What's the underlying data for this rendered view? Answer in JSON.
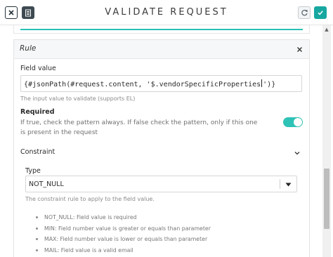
{
  "header": {
    "title": "VALIDATE REQUEST",
    "close_icon": "close-icon",
    "doc_icon": "document-icon",
    "refresh_icon": "refresh-icon",
    "check_icon": "check-icon"
  },
  "rule": {
    "title": "Rule",
    "field_value": {
      "label": "Field value",
      "value_before_caret": "{#jsonPath(#request.content, '$.vendorSpecificProperties",
      "value_after_caret": "')}",
      "hint": "The input value to validate (supports EL)"
    },
    "required": {
      "title": "Required",
      "description": "If true, check the pattern always. If false check the pattern, only if this one is present in the request",
      "enabled": true
    },
    "constraint": {
      "title": "Constraint",
      "type_label": "Type",
      "type_value": "NOT_NULL",
      "type_hint": "The constraint rule to apply to the field value.",
      "items": [
        "NOT_NULL: Field value is required",
        "MIN: Field number value is greater or equals than parameter",
        "MAX: Field number value is lower or equals than parameter",
        "MAIL: Field value is a valid email"
      ]
    }
  },
  "colors": {
    "accent": "#2fc2b7",
    "dark": "#3e4a52"
  }
}
